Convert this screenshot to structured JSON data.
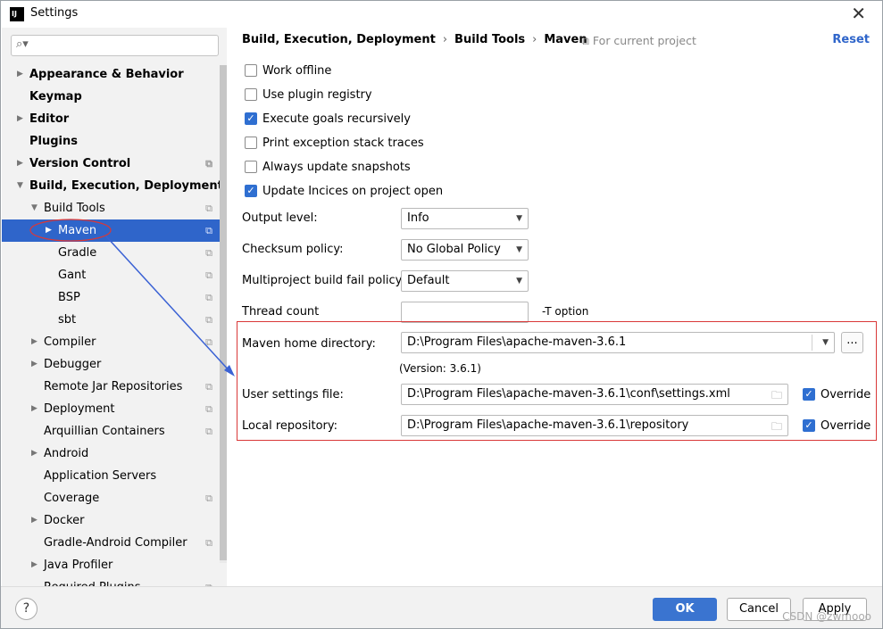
{
  "window": {
    "title": "Settings",
    "app_icon": "IJ"
  },
  "search": {
    "placeholder": ""
  },
  "tree": [
    {
      "label": "Appearance & Behavior",
      "arrow": "▶",
      "bold": true,
      "project": false
    },
    {
      "label": "Keymap",
      "arrow": "",
      "bold": true,
      "project": false
    },
    {
      "label": "Editor",
      "arrow": "▶",
      "bold": true,
      "project": false
    },
    {
      "label": "Plugins",
      "arrow": "",
      "bold": true,
      "project": false
    },
    {
      "label": "Version Control",
      "arrow": "▶",
      "bold": true,
      "project": true
    },
    {
      "label": "Build, Execution, Deployment",
      "arrow": "▼",
      "bold": true,
      "project": false
    },
    {
      "label": "Build Tools",
      "arrow": "▼",
      "bold": false,
      "project": true
    },
    {
      "label": "Maven",
      "arrow": "▶",
      "bold": false,
      "project": true,
      "selected": true
    },
    {
      "label": "Gradle",
      "arrow": "",
      "bold": false,
      "project": true
    },
    {
      "label": "Gant",
      "arrow": "",
      "bold": false,
      "project": true
    },
    {
      "label": "BSP",
      "arrow": "",
      "bold": false,
      "project": true
    },
    {
      "label": "sbt",
      "arrow": "",
      "bold": false,
      "project": true
    },
    {
      "label": "Compiler",
      "arrow": "▶",
      "bold": false,
      "project": true
    },
    {
      "label": "Debugger",
      "arrow": "▶",
      "bold": false,
      "project": false
    },
    {
      "label": "Remote Jar Repositories",
      "arrow": "",
      "bold": false,
      "project": true
    },
    {
      "label": "Deployment",
      "arrow": "▶",
      "bold": false,
      "project": true
    },
    {
      "label": "Arquillian Containers",
      "arrow": "",
      "bold": false,
      "project": true
    },
    {
      "label": "Android",
      "arrow": "▶",
      "bold": false,
      "project": false
    },
    {
      "label": "Application Servers",
      "arrow": "",
      "bold": false,
      "project": false
    },
    {
      "label": "Coverage",
      "arrow": "",
      "bold": false,
      "project": true
    },
    {
      "label": "Docker",
      "arrow": "▶",
      "bold": false,
      "project": false
    },
    {
      "label": "Gradle-Android Compiler",
      "arrow": "",
      "bold": false,
      "project": true
    },
    {
      "label": "Java Profiler",
      "arrow": "▶",
      "bold": false,
      "project": false
    },
    {
      "label": "Required Plugins",
      "arrow": "",
      "bold": false,
      "project": true
    }
  ],
  "breadcrumb": {
    "part1": "Build, Execution, Deployment",
    "sep1": "›",
    "part2": "Build Tools",
    "sep2": "›",
    "part3": "Maven"
  },
  "scope": "For current project",
  "reset": "Reset",
  "checkboxes": [
    {
      "label": "Work offline",
      "checked": false
    },
    {
      "label": "Use plugin registry",
      "checked": false
    },
    {
      "label": "Execute goals recursively",
      "checked": true
    },
    {
      "label": "Print exception stack traces",
      "checked": false
    },
    {
      "label": "Always update snapshots",
      "checked": false
    },
    {
      "label": "Update Incices on project open",
      "checked": true
    }
  ],
  "fields": {
    "output_level": {
      "label": "Output level:",
      "value": "Info"
    },
    "checksum": {
      "label": "Checksum policy:",
      "value": "No Global Policy"
    },
    "multiproject": {
      "label": "Multiproject build fail policy:",
      "value": "Default"
    },
    "thread": {
      "label": "Thread count",
      "value": "",
      "suffix": "-T option"
    },
    "maven_home": {
      "label": "Maven home directory:",
      "value": "D:\\Program Files\\apache-maven-3.6.1",
      "browse": "...",
      "version": "(Version: 3.6.1)"
    },
    "user_settings": {
      "label": "User settings file:",
      "value": "D:\\Program Files\\apache-maven-3.6.1\\conf\\settings.xml",
      "override": "Override",
      "override_checked": true
    },
    "local_repo": {
      "label": "Local repository:",
      "value": "D:\\Program Files\\apache-maven-3.6.1\\repository",
      "override": "Override",
      "override_checked": true
    }
  },
  "footer": {
    "help": "?",
    "ok": "OK",
    "cancel": "Cancel",
    "apply": "Apply"
  },
  "watermark": "CSDN @zwmooo",
  "colors": {
    "accent": "#2f65ca",
    "annotation_red": "#d93838",
    "annotation_arrow": "#3b62d4"
  }
}
